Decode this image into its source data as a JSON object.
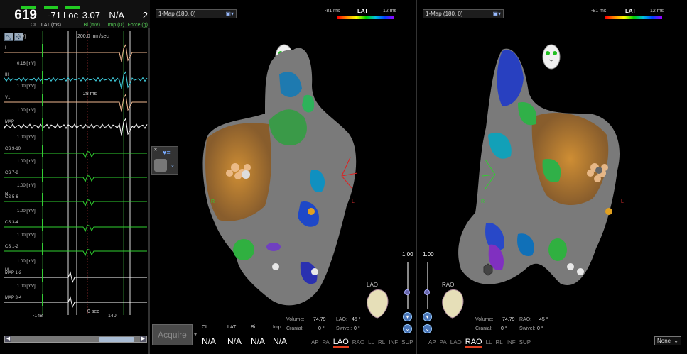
{
  "stats": [
    {
      "value": "619",
      "label": "CL",
      "big": true,
      "green": false
    },
    {
      "value": "-71",
      "label": "LAT (ms)",
      "big": false,
      "green": false
    },
    {
      "value": "Loc",
      "label": "",
      "big": false,
      "green": false
    },
    {
      "value": "3.07",
      "label": "Bi (mV)",
      "big": false,
      "green": true
    },
    {
      "value": "N/A",
      "label": "Imp (Ω)",
      "big": false,
      "green": true
    },
    {
      "value": "2",
      "label": "Force (g)",
      "big": false,
      "green": true
    }
  ],
  "egm": {
    "speed": "200.0 mm/sec",
    "lat_readout": "28 ms",
    "axis_left": "-148",
    "axis_mid": "0 sec",
    "axis_right": "140",
    "channels": [
      {
        "name": "I",
        "scale": "[mV]",
        "color": "#f0b890"
      },
      {
        "name": "III",
        "scale": "0.16 [mV]",
        "color": "#40d0e0"
      },
      {
        "name": "V1",
        "scale": "1.00 [mV]",
        "color": "#f0b890"
      },
      {
        "name": "MAP",
        "scale": "1.00 [mV]",
        "color": "#ffffff"
      },
      {
        "name": "CS 9-10",
        "scale": "1.00 [mV]",
        "color": "#30d030"
      },
      {
        "name": "CS 7-8",
        "scale": "1.00 [mV]",
        "color": "#30d030"
      },
      {
        "name": "CS 5-6",
        "scale": "1.00 [mV]",
        "color": "#30d030"
      },
      {
        "name": "CS 3-4",
        "scale": "1.00 [mV]",
        "color": "#30d030"
      },
      {
        "name": "CS 1-2",
        "scale": "1.00 [mV]",
        "color": "#30d030"
      },
      {
        "name": "MAP 1-2",
        "scale": "1.00 [mV]",
        "color": "#ffffff"
      },
      {
        "name": "MAP 3-4",
        "scale": "1.00 [mV]",
        "color": "#ffffff"
      }
    ],
    "side_labels": {
      "r": "R",
      "m": "M"
    }
  },
  "map_left": {
    "dropdown": "1-Map (180, 0)",
    "lat_title": "LAT",
    "lat_min": "-81 ms",
    "lat_max": "12 ms",
    "zoom": "1.00",
    "view": "LAO",
    "marker_r": "R",
    "marker_l": "L",
    "info": {
      "volume_label": "Volume:",
      "volume": "74.79",
      "view_label": "LAO:",
      "view_angle": "45 °",
      "cranial_label": "Cranial:",
      "cranial": "0 °",
      "swivel_label": "Swivel:",
      "swivel": "0 °"
    },
    "tabs": [
      "AP",
      "PA",
      "LAO",
      "RAO",
      "LL",
      "RL",
      "INF",
      "SUP"
    ],
    "active_tab": "LAO"
  },
  "map_right": {
    "dropdown": "1-Map (180, 0)",
    "lat_title": "LAT",
    "lat_min": "-81 ms",
    "lat_max": "12 ms",
    "zoom": "1.00",
    "view": "RAO",
    "marker_r": "R",
    "marker_l": "L",
    "info": {
      "volume_label": "Volume:",
      "volume": "74.79",
      "view_label": "RAO:",
      "view_angle": "45 °",
      "cranial_label": "Cranial:",
      "cranial": "0 °",
      "swivel_label": "Swivel:",
      "swivel": "0 °"
    },
    "tabs": [
      "AP",
      "PA",
      "LAO",
      "RAO",
      "LL",
      "RL",
      "INF",
      "SUP"
    ],
    "active_tab": "RAO",
    "none_select": "None"
  },
  "acquire": {
    "label": "Acquire",
    "columns": [
      {
        "header": "CL",
        "value": "N/A"
      },
      {
        "header": "LAT",
        "value": "N/A"
      },
      {
        "header": "Bi",
        "value": "N/A"
      },
      {
        "header": "Imp",
        "value": "N/A"
      }
    ]
  }
}
